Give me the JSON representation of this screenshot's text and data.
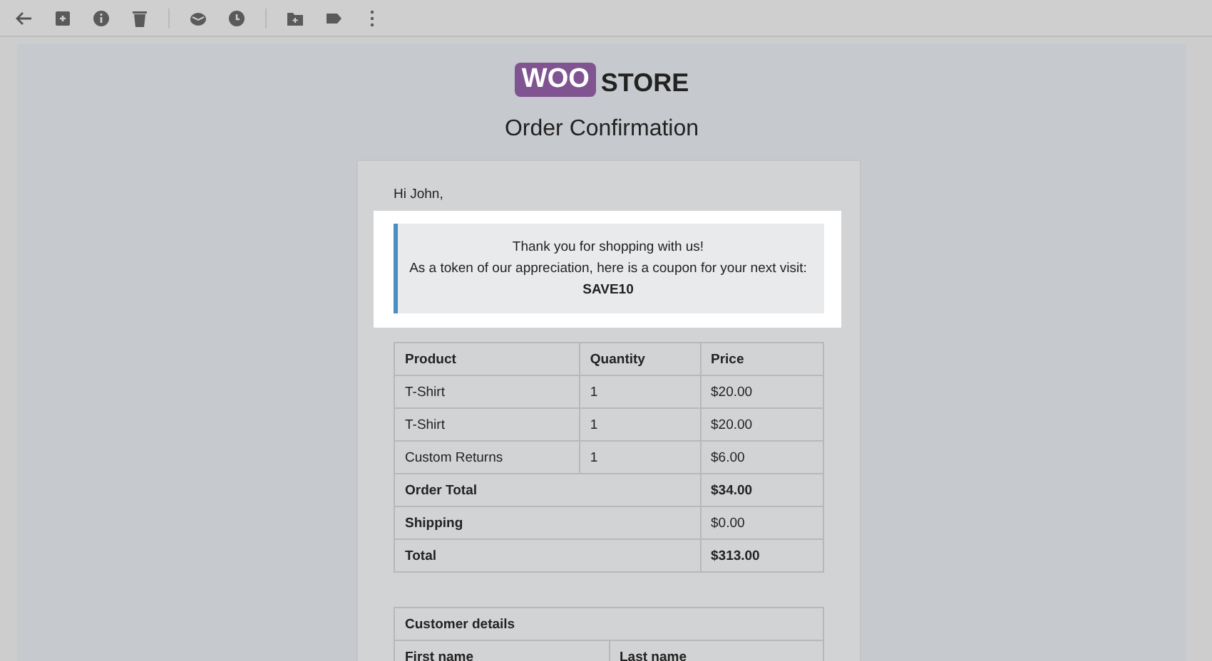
{
  "logo": {
    "badge": "WOO",
    "text": "STORE"
  },
  "title": "Order Confirmation",
  "greeting": "Hi John,",
  "coupon": {
    "lines": [
      "Thank you for shopping with us!",
      "As a token of our appreciation, here is a coupon for your next visit:"
    ],
    "code": "SAVE10"
  },
  "order_table": {
    "columns": [
      "Product",
      "Quantity",
      "Price"
    ],
    "rows": [
      [
        "T-Shirt",
        "1",
        "$20.00"
      ],
      [
        "T-Shirt",
        "1",
        "$20.00"
      ],
      [
        "Custom Returns",
        "1",
        "$6.00"
      ]
    ],
    "totals": [
      {
        "label": "Order Total",
        "value": "$34.00",
        "strong": true
      },
      {
        "label": "Shipping",
        "value": "$0.00",
        "strong": false
      },
      {
        "label": "Total",
        "value": "$313.00",
        "strong": true
      }
    ]
  },
  "customer_table": {
    "title": "Customer details",
    "columns": [
      "First name",
      "Last name"
    ]
  }
}
